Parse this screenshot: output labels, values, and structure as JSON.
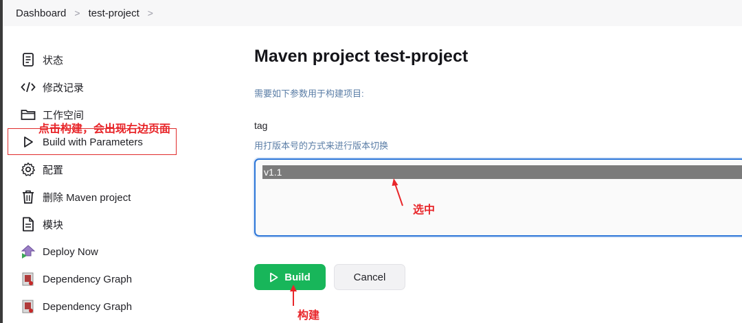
{
  "breadcrumb": {
    "items": [
      "Dashboard",
      "test-project"
    ],
    "separator": ">"
  },
  "sidebar": {
    "items": [
      {
        "label": "状态",
        "icon": "document-icon"
      },
      {
        "label": "修改记录",
        "icon": "code-icon"
      },
      {
        "label": "工作空间",
        "icon": "folder-icon"
      },
      {
        "label": "Build with Parameters",
        "icon": "play-icon"
      },
      {
        "label": "配置",
        "icon": "gear-icon"
      },
      {
        "label": "删除 Maven project",
        "icon": "trash-icon"
      },
      {
        "label": "模块",
        "icon": "file-icon"
      },
      {
        "label": "Deploy Now",
        "icon": "deploy-icon"
      },
      {
        "label": "Dependency Graph",
        "icon": "dependency-graph-icon"
      },
      {
        "label": "Dependency Graph",
        "icon": "dependency-graph-icon"
      }
    ]
  },
  "annotations": {
    "sidebar_note": "点击构建，会出现右边页面",
    "select_note": "选中",
    "build_note": "构建",
    "color": "#e8262a"
  },
  "main": {
    "title": "Maven project test-project",
    "subtitle": "需要如下参数用于构建项目:",
    "parameter": {
      "name": "tag",
      "description": "用打版本号的方式来进行版本切换",
      "selected_option": "v1.1"
    },
    "buttons": {
      "build": "Build",
      "cancel": "Cancel"
    }
  },
  "colors": {
    "build_button": "#18b65a",
    "focus_border": "#2b75d8",
    "selected_option_bg": "#7b7b7b",
    "description_text": "#5a7da6"
  }
}
